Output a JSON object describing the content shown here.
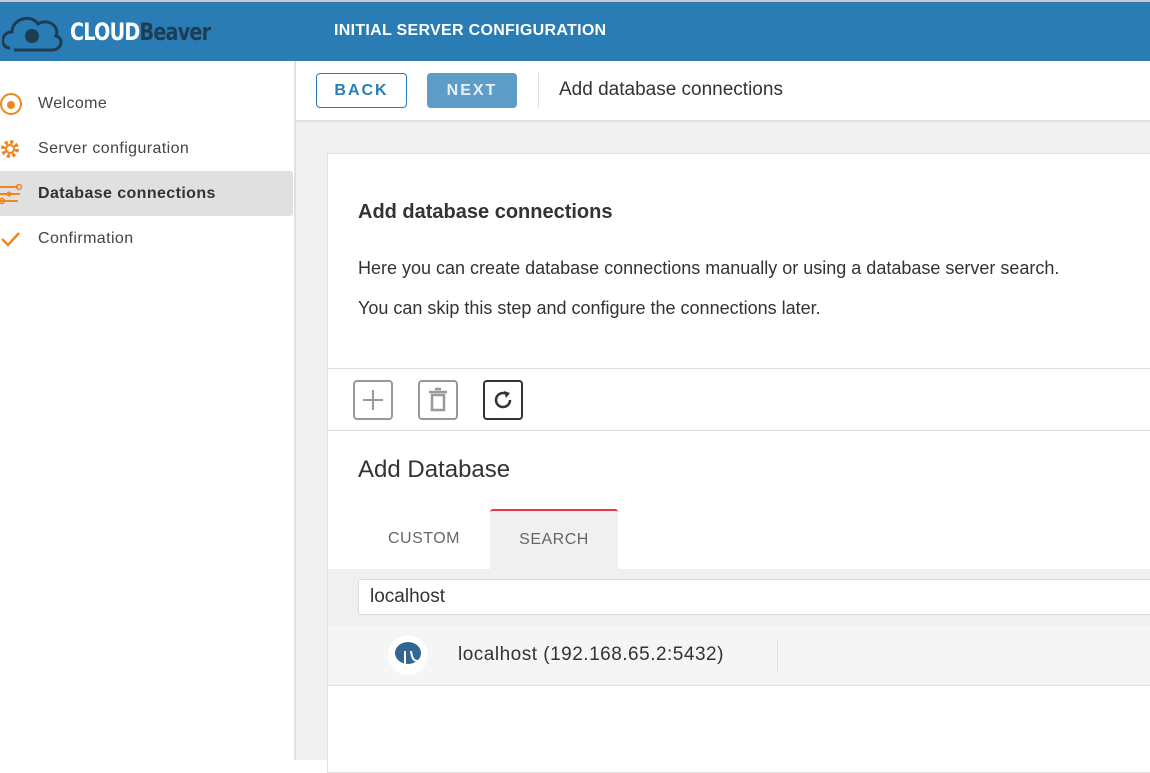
{
  "header": {
    "logo_part1": "CLOUD",
    "logo_part2": "Beaver",
    "title": "INITIAL SERVER CONFIGURATION",
    "color": "#2a7cb4"
  },
  "sidebar": {
    "items": [
      {
        "label": "Welcome",
        "icon": "beaver-icon"
      },
      {
        "label": "Server configuration",
        "icon": "gear-icon"
      },
      {
        "label": "Database connections",
        "icon": "connections-icon",
        "active": true
      },
      {
        "label": "Confirmation",
        "icon": "check-icon"
      }
    ]
  },
  "topbar": {
    "back_label": "BACK",
    "next_label": "NEXT",
    "step_title": "Add database connections"
  },
  "card": {
    "title": "Add database connections",
    "text1": "Here you can create database connections manually or using a database server search.",
    "text2": "You can skip this step and configure the connections later.",
    "toolbar": [
      "plus-icon",
      "trash-icon",
      "refresh-icon"
    ],
    "add_db_title": "Add Database",
    "tabs": [
      {
        "label": "CUSTOM"
      },
      {
        "label": "SEARCH",
        "active": true
      }
    ],
    "search_value": "localhost",
    "results": [
      {
        "label": "localhost (192.168.65.2:5432)",
        "icon": "postgresql-icon"
      }
    ]
  }
}
